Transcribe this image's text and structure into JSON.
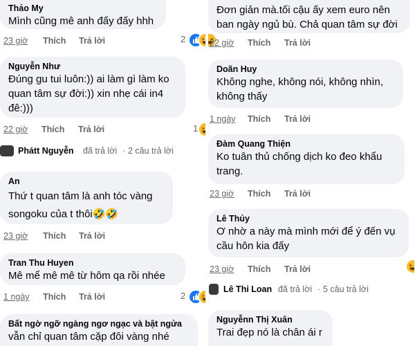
{
  "left": {
    "c1": {
      "author": "Thảo My",
      "lines": [
        "Mình cũng mê anh đấy đấy hhh"
      ],
      "time": "23 giờ",
      "like": "Thích",
      "reply": "Trả lời",
      "react_count": "2"
    },
    "c2": {
      "author": "Nguyễn Như",
      "lines": [
        "Đúng gu tui luôn:)) ai làm gì làm ko",
        "quan tâm sự đời:)) xin nhẹ cái in4",
        "đê:)))"
      ],
      "time": "22 giờ",
      "like": "Thích",
      "reply": "Trả lời",
      "react_count": "1"
    },
    "thread1": {
      "name": "Phátt Nguyễn",
      "verb": "đã trả lời",
      "sep": "·",
      "count": "2 câu trả lời"
    },
    "c3": {
      "author": "An",
      "lines": [
        "Thứ t quan tâm là anh tóc vàng",
        "songoku của t thôi🤣🤣"
      ],
      "time": "23 giờ",
      "like": "Thích",
      "reply": "Trả lời"
    },
    "c4": {
      "author": "Tran Thu Huyen",
      "lines": [
        "Mê mể mê mê từ hôm qa rồi nhée"
      ],
      "time": "1 ngày",
      "like": "Thích",
      "reply": "Trả lời",
      "react_count": "2"
    },
    "c5": {
      "author": "Bất ngờ ngỡ ngàng ngơ ngạc và bật ngửa",
      "lines": [
        "vẫn chỉ quan tâm cặp đôi vàng nhé"
      ]
    }
  },
  "right": {
    "r1": {
      "lines": [
        "Đơn giản mà.tối cậu ấy xem euro nên",
        "ban ngày ngủ bù. Chả quan tâm sự đời"
      ],
      "time": "22 giờ",
      "like": "Thích",
      "reply": "Trả lời"
    },
    "r2": {
      "author": "Doãn Huy",
      "lines": [
        "Không nghe, không nói, không nhìn,",
        "không thấy"
      ],
      "time": "1 ngày",
      "like": "Thích",
      "reply": "Trả lời"
    },
    "r3": {
      "author": "Đàm Quang Thiện",
      "lines": [
        "Ko tuân thủ chống dịch ko đeo khẩu",
        "trang."
      ],
      "time": "23 giờ",
      "like": "Thích",
      "reply": "Trả lời"
    },
    "r4": {
      "author": "Lê Thủy",
      "lines": [
        "Ơ nhờ a này mà mình mới để ý đến vụ",
        "cầu hôn kia đấy"
      ],
      "time": "23 giờ",
      "like": "Thích",
      "reply": "Trả lời"
    },
    "thread2": {
      "name": "Lê Thi Loan",
      "verb": "đã trả lời",
      "sep": "·",
      "count": "5 câu trả lời"
    },
    "r5": {
      "author": "Nguyễnn Thị Xuân",
      "lines": [
        "Trai đẹp nó là chân ái r"
      ]
    }
  },
  "colors": {
    "bubble": "#f0f2f5",
    "meta": "#65676b",
    "like": "#1877f2",
    "haha": "#f7b928"
  }
}
